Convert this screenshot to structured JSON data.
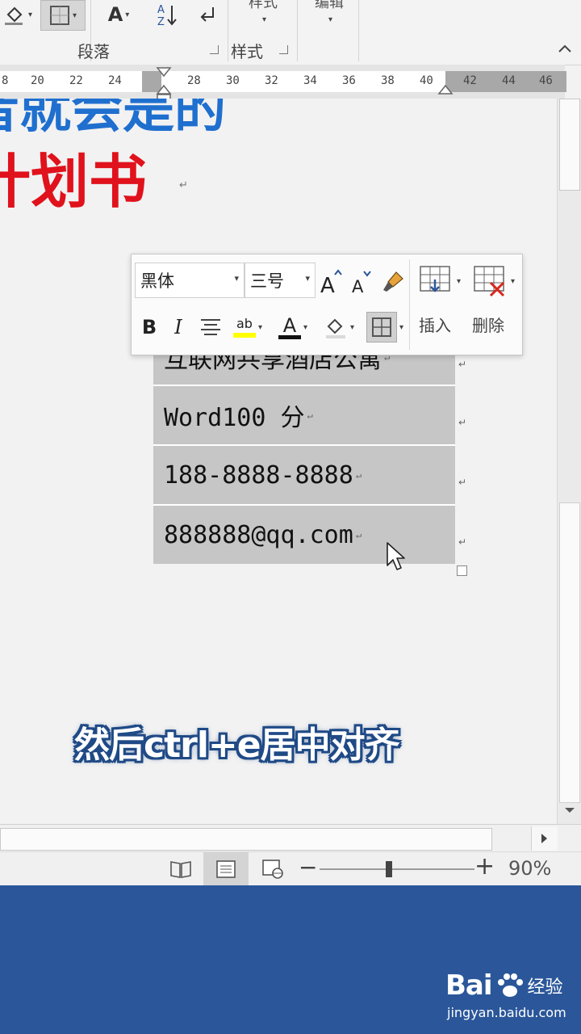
{
  "ribbon": {
    "paragraph_group_label": "段落",
    "styles_group_label": "样式",
    "styles_button_label": "样式",
    "editing_button_label": "编辑"
  },
  "ruler": {
    "ticks": [
      "8",
      "20",
      "22",
      "24",
      "28",
      "30",
      "32",
      "34",
      "36",
      "38",
      "40",
      "42",
      "44",
      "46"
    ]
  },
  "document": {
    "heading_line1": "者就会是的",
    "heading_line2": "计划书",
    "table_rows": [
      "互联网共享酒店公寓",
      "Word100 分",
      "188-8888-8888",
      "888888@qq.com"
    ]
  },
  "mini_toolbar": {
    "font_name": "黑体",
    "font_size": "三号",
    "insert_label": "插入",
    "delete_label": "删除",
    "bold_label": "B",
    "italic_label": "I",
    "highlight_label": "ab",
    "font_color_label": "A",
    "colors": {
      "highlight": "#ffff00",
      "font_color": "#111111",
      "delete_red": "#d9261c"
    }
  },
  "subtitle": "然后ctrl+e居中对齐",
  "statusbar": {
    "zoom_percent": "90%",
    "zoom_minus": "−",
    "zoom_plus": "+",
    "zoom_level": 0.45
  },
  "watermark": {
    "brand": "Bai",
    "brand_suffix": "经验",
    "url": "jingyan.baidu.com"
  },
  "colors": {
    "heading_blue": "#1f6fcf",
    "heading_red": "#e0121c",
    "word_blue": "#2b579a",
    "table_fill": "#c6c6c6"
  }
}
